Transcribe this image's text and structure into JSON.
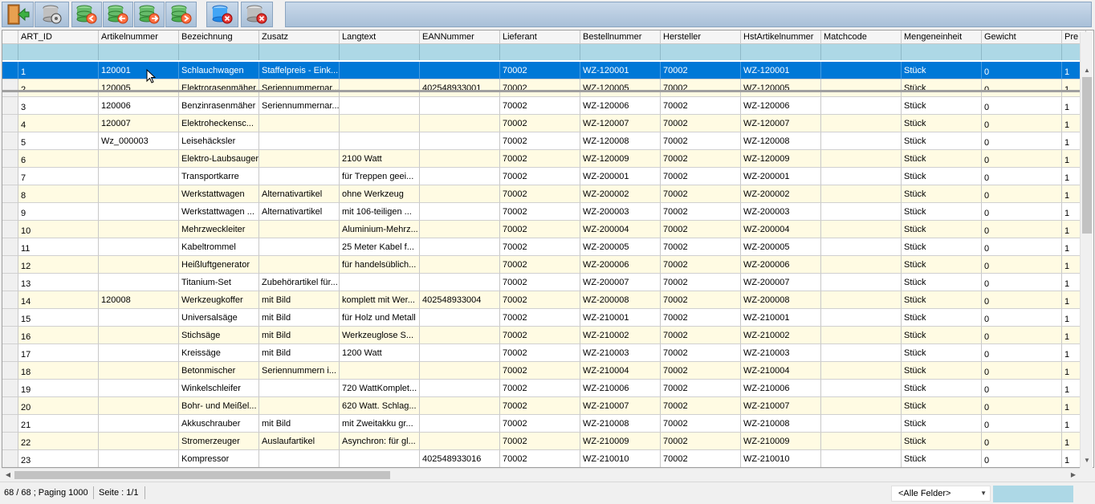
{
  "toolbar": {
    "buttons": [
      {
        "name": "exit-button",
        "icon": "exit-door-icon"
      },
      {
        "name": "database-settings-button",
        "icon": "database-gear-icon"
      },
      {
        "name": "first-record-button",
        "icon": "database-first-icon"
      },
      {
        "name": "previous-record-button",
        "icon": "database-previous-icon"
      },
      {
        "name": "next-record-button",
        "icon": "database-next-icon"
      },
      {
        "name": "last-record-button",
        "icon": "database-last-icon"
      },
      {
        "name": "delete-record-button",
        "icon": "database-delete-icon"
      },
      {
        "name": "delete-all-button",
        "icon": "database-delete-grey-icon"
      }
    ]
  },
  "grid": {
    "columns": [
      "ART_ID",
      "Artikelnummer",
      "Bezeichnung",
      "Zusatz",
      "Langtext",
      "EANNummer",
      "Lieferant",
      "Bestellnummer",
      "Hersteller",
      "HstArtikelnummer",
      "Matchcode",
      "Mengeneinheit",
      "Gewicht",
      "Pre"
    ],
    "rows": [
      [
        "1",
        "120001",
        "Schlauchwagen",
        "Staffelpreis - Eink...",
        "",
        "",
        "70002",
        "WZ-120001",
        "70002",
        "WZ-120001",
        "",
        "Stück",
        "0",
        "1"
      ],
      [
        "2",
        "120005",
        "Elektrorasenmäher",
        "Seriennummernar...",
        "",
        "402548933001",
        "70002",
        "WZ-120005",
        "70002",
        "WZ-120005",
        "",
        "Stück",
        "0",
        "1"
      ],
      [
        "3",
        "120006",
        "Benzinrasenmäher",
        "Seriennummernar...",
        "",
        "",
        "70002",
        "WZ-120006",
        "70002",
        "WZ-120006",
        "",
        "Stück",
        "0",
        "1"
      ],
      [
        "4",
        "120007",
        "Elektroheckensc...",
        "",
        "",
        "",
        "70002",
        "WZ-120007",
        "70002",
        "WZ-120007",
        "",
        "Stück",
        "0",
        "1"
      ],
      [
        "5",
        "Wz_000003",
        "Leisehäcksler",
        "",
        "",
        "",
        "70002",
        "WZ-120008",
        "70002",
        "WZ-120008",
        "",
        "Stück",
        "0",
        "1"
      ],
      [
        "6",
        "",
        "Elektro-Laubsauger",
        "",
        "2100 Watt",
        "",
        "70002",
        "WZ-120009",
        "70002",
        "WZ-120009",
        "",
        "Stück",
        "0",
        "1"
      ],
      [
        "7",
        "",
        "Transportkarre",
        "",
        "für Treppen geei...",
        "",
        "70002",
        "WZ-200001",
        "70002",
        "WZ-200001",
        "",
        "Stück",
        "0",
        "1"
      ],
      [
        "8",
        "",
        "Werkstattwagen",
        "Alternativartikel",
        "ohne Werkzeug",
        "",
        "70002",
        "WZ-200002",
        "70002",
        "WZ-200002",
        "",
        "Stück",
        "0",
        "1"
      ],
      [
        "9",
        "",
        "Werkstattwagen ...",
        "Alternativartikel",
        "mit 106-teiligen ...",
        "",
        "70002",
        "WZ-200003",
        "70002",
        "WZ-200003",
        "",
        "Stück",
        "0",
        "1"
      ],
      [
        "10",
        "",
        "Mehrzweckleiter",
        "",
        "Aluminium-Mehrz...",
        "",
        "70002",
        "WZ-200004",
        "70002",
        "WZ-200004",
        "",
        "Stück",
        "0",
        "1"
      ],
      [
        "11",
        "",
        "Kabeltrommel",
        "",
        "25 Meter Kabel f...",
        "",
        "70002",
        "WZ-200005",
        "70002",
        "WZ-200005",
        "",
        "Stück",
        "0",
        "1"
      ],
      [
        "12",
        "",
        "Heißluftgenerator",
        "",
        "für handelsüblich...",
        "",
        "70002",
        "WZ-200006",
        "70002",
        "WZ-200006",
        "",
        "Stück",
        "0",
        "1"
      ],
      [
        "13",
        "",
        "Titanium-Set",
        "Zubehörartikel für...",
        "",
        "",
        "70002",
        "WZ-200007",
        "70002",
        "WZ-200007",
        "",
        "Stück",
        "0",
        "1"
      ],
      [
        "14",
        "120008",
        "Werkzeugkoffer",
        "mit Bild",
        "komplett mit Wer...",
        "402548933004",
        "70002",
        "WZ-200008",
        "70002",
        "WZ-200008",
        "",
        "Stück",
        "0",
        "1"
      ],
      [
        "15",
        "",
        "Universalsäge",
        "mit Bild",
        "für Holz und Metall",
        "",
        "70002",
        "WZ-210001",
        "70002",
        "WZ-210001",
        "",
        "Stück",
        "0",
        "1"
      ],
      [
        "16",
        "",
        "Stichsäge",
        "mit Bild",
        "Werkzeuglose S...",
        "",
        "70002",
        "WZ-210002",
        "70002",
        "WZ-210002",
        "",
        "Stück",
        "0",
        "1"
      ],
      [
        "17",
        "",
        "Kreissäge",
        "mit Bild",
        "1200 Watt",
        "",
        "70002",
        "WZ-210003",
        "70002",
        "WZ-210003",
        "",
        "Stück",
        "0",
        "1"
      ],
      [
        "18",
        "",
        "Betonmischer",
        "Seriennummern i...",
        "",
        "",
        "70002",
        "WZ-210004",
        "70002",
        "WZ-210004",
        "",
        "Stück",
        "0",
        "1"
      ],
      [
        "19",
        "",
        "Winkelschleifer",
        "",
        "720 WattKomplet...",
        "",
        "70002",
        "WZ-210006",
        "70002",
        "WZ-210006",
        "",
        "Stück",
        "0",
        "1"
      ],
      [
        "20",
        "",
        "Bohr- und Meißel...",
        "",
        "620 Watt. Schlag...",
        "",
        "70002",
        "WZ-210007",
        "70002",
        "WZ-210007",
        "",
        "Stück",
        "0",
        "1"
      ],
      [
        "21",
        "",
        "Akkuschrauber",
        "mit Bild",
        "mit Zweitakku gr...",
        "",
        "70002",
        "WZ-210008",
        "70002",
        "WZ-210008",
        "",
        "Stück",
        "0",
        "1"
      ],
      [
        "22",
        "",
        "Stromerzeuger",
        "Auslaufartikel",
        "Asynchron: für gl...",
        "",
        "70002",
        "WZ-210009",
        "70002",
        "WZ-210009",
        "",
        "Stück",
        "0",
        "1"
      ],
      [
        "23",
        "",
        "Kompressor",
        "",
        "",
        "402548933016",
        "70002",
        "WZ-210010",
        "70002",
        "WZ-210010",
        "",
        "Stück",
        "0",
        "1"
      ]
    ],
    "selected_row": 0
  },
  "status": {
    "records": "68 / 68 ; Paging 1000",
    "page": "Seite : 1/1",
    "field_filter": "<Alle Felder>",
    "search_value": ""
  },
  "colors": {
    "selection": "#0078d7",
    "row_alt": "#fffbe3",
    "filter_row": "#add8e6",
    "toolbar": "#b9cde2"
  }
}
